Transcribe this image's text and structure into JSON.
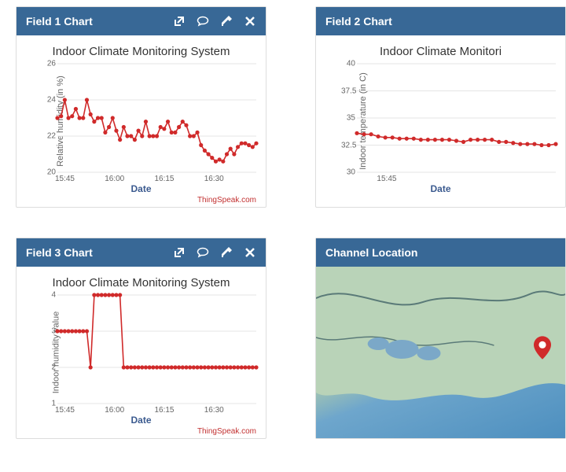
{
  "attribution": "ThingSpeak.com",
  "panels": {
    "field1": {
      "title": "Field 1 Chart"
    },
    "field2": {
      "title": "Field 2 Chart"
    },
    "field3": {
      "title": "Field 3 Chart"
    },
    "location": {
      "title": "Channel Location"
    }
  },
  "icons": [
    "external-link-icon",
    "comment-icon",
    "edit-icon",
    "close-icon"
  ],
  "chart_data": [
    {
      "id": "field1",
      "type": "line",
      "title": "Indoor Climate Monitoring System",
      "xlabel": "Date",
      "ylabel": "Relative humidity (in %)",
      "ylim": [
        20,
        26
      ],
      "y_ticks": [
        20,
        22,
        24,
        26
      ],
      "x_categories": [
        "15:45",
        "16:00",
        "16:15",
        "16:30"
      ],
      "x": [
        0,
        1,
        2,
        3,
        4,
        5,
        6,
        7,
        8,
        9,
        10,
        11,
        12,
        13,
        14,
        15,
        16,
        17,
        18,
        19,
        20,
        21,
        22,
        23,
        24,
        25,
        26,
        27,
        28,
        29,
        30,
        31,
        32,
        33,
        34,
        35,
        36,
        37,
        38,
        39,
        40,
        41,
        42,
        43,
        44,
        45,
        46,
        47,
        48,
        49,
        50,
        51,
        52,
        53,
        54
      ],
      "values": [
        23.0,
        23.1,
        24.0,
        23.0,
        23.1,
        23.5,
        23.0,
        23.0,
        24.0,
        23.2,
        22.8,
        23.0,
        23.0,
        22.2,
        22.5,
        23.0,
        22.3,
        21.8,
        22.5,
        22.0,
        22.0,
        21.8,
        22.3,
        22.0,
        22.8,
        22.0,
        22.0,
        22.0,
        22.5,
        22.4,
        22.8,
        22.2,
        22.2,
        22.5,
        22.8,
        22.6,
        22.0,
        22.0,
        22.2,
        21.5,
        21.2,
        21.0,
        20.8,
        20.6,
        20.7,
        20.6,
        21.0,
        21.3,
        21.0,
        21.4,
        21.6,
        21.6,
        21.5,
        21.4,
        21.6
      ]
    },
    {
      "id": "field2",
      "type": "line",
      "title": "Indoor Climate Monitori",
      "xlabel": "Date",
      "ylabel": "Indoor temperature (in C)",
      "ylim": [
        30,
        40
      ],
      "y_ticks": [
        30,
        32.5,
        35,
        37.5,
        40
      ],
      "x_categories": [
        "15:45"
      ],
      "x": [
        0,
        1,
        2,
        3,
        4,
        5,
        6,
        7,
        8,
        9,
        10,
        11,
        12,
        13,
        14,
        15,
        16,
        17,
        18,
        19,
        20,
        21,
        22,
        23,
        24,
        25,
        26,
        27,
        28
      ],
      "values": [
        33.6,
        33.5,
        33.5,
        33.3,
        33.2,
        33.2,
        33.1,
        33.1,
        33.1,
        33.0,
        33.0,
        33.0,
        33.0,
        33.0,
        32.9,
        32.8,
        33.0,
        33.0,
        33.0,
        33.0,
        32.8,
        32.8,
        32.7,
        32.6,
        32.6,
        32.6,
        32.5,
        32.5,
        32.6
      ]
    },
    {
      "id": "field3",
      "type": "line",
      "title": "Indoor Climate Monitoring System",
      "xlabel": "Date",
      "ylabel": "Indoor humidity value",
      "ylim": [
        1,
        4
      ],
      "y_ticks": [
        1,
        2,
        3,
        4
      ],
      "x_categories": [
        "15:45",
        "16:00",
        "16:15",
        "16:30"
      ],
      "x": [
        0,
        1,
        2,
        3,
        4,
        5,
        6,
        7,
        8,
        9,
        10,
        11,
        12,
        13,
        14,
        15,
        16,
        17,
        18,
        19,
        20,
        21,
        22,
        23,
        24,
        25,
        26,
        27,
        28,
        29,
        30,
        31,
        32,
        33,
        34,
        35,
        36,
        37,
        38,
        39,
        40,
        41,
        42,
        43,
        44,
        45,
        46,
        47,
        48,
        49,
        50,
        51,
        52,
        53,
        54
      ],
      "values": [
        3,
        3,
        3,
        3,
        3,
        3,
        3,
        3,
        3,
        2,
        4,
        4,
        4,
        4,
        4,
        4,
        4,
        4,
        2,
        2,
        2,
        2,
        2,
        2,
        2,
        2,
        2,
        2,
        2,
        2,
        2,
        2,
        2,
        2,
        2,
        2,
        2,
        2,
        2,
        2,
        2,
        2,
        2,
        2,
        2,
        2,
        2,
        2,
        2,
        2,
        2,
        2,
        2,
        2,
        2
      ]
    }
  ],
  "colors": {
    "header": "#386896",
    "series": "#d02a2a",
    "xlabel": "#3b5a8f"
  }
}
